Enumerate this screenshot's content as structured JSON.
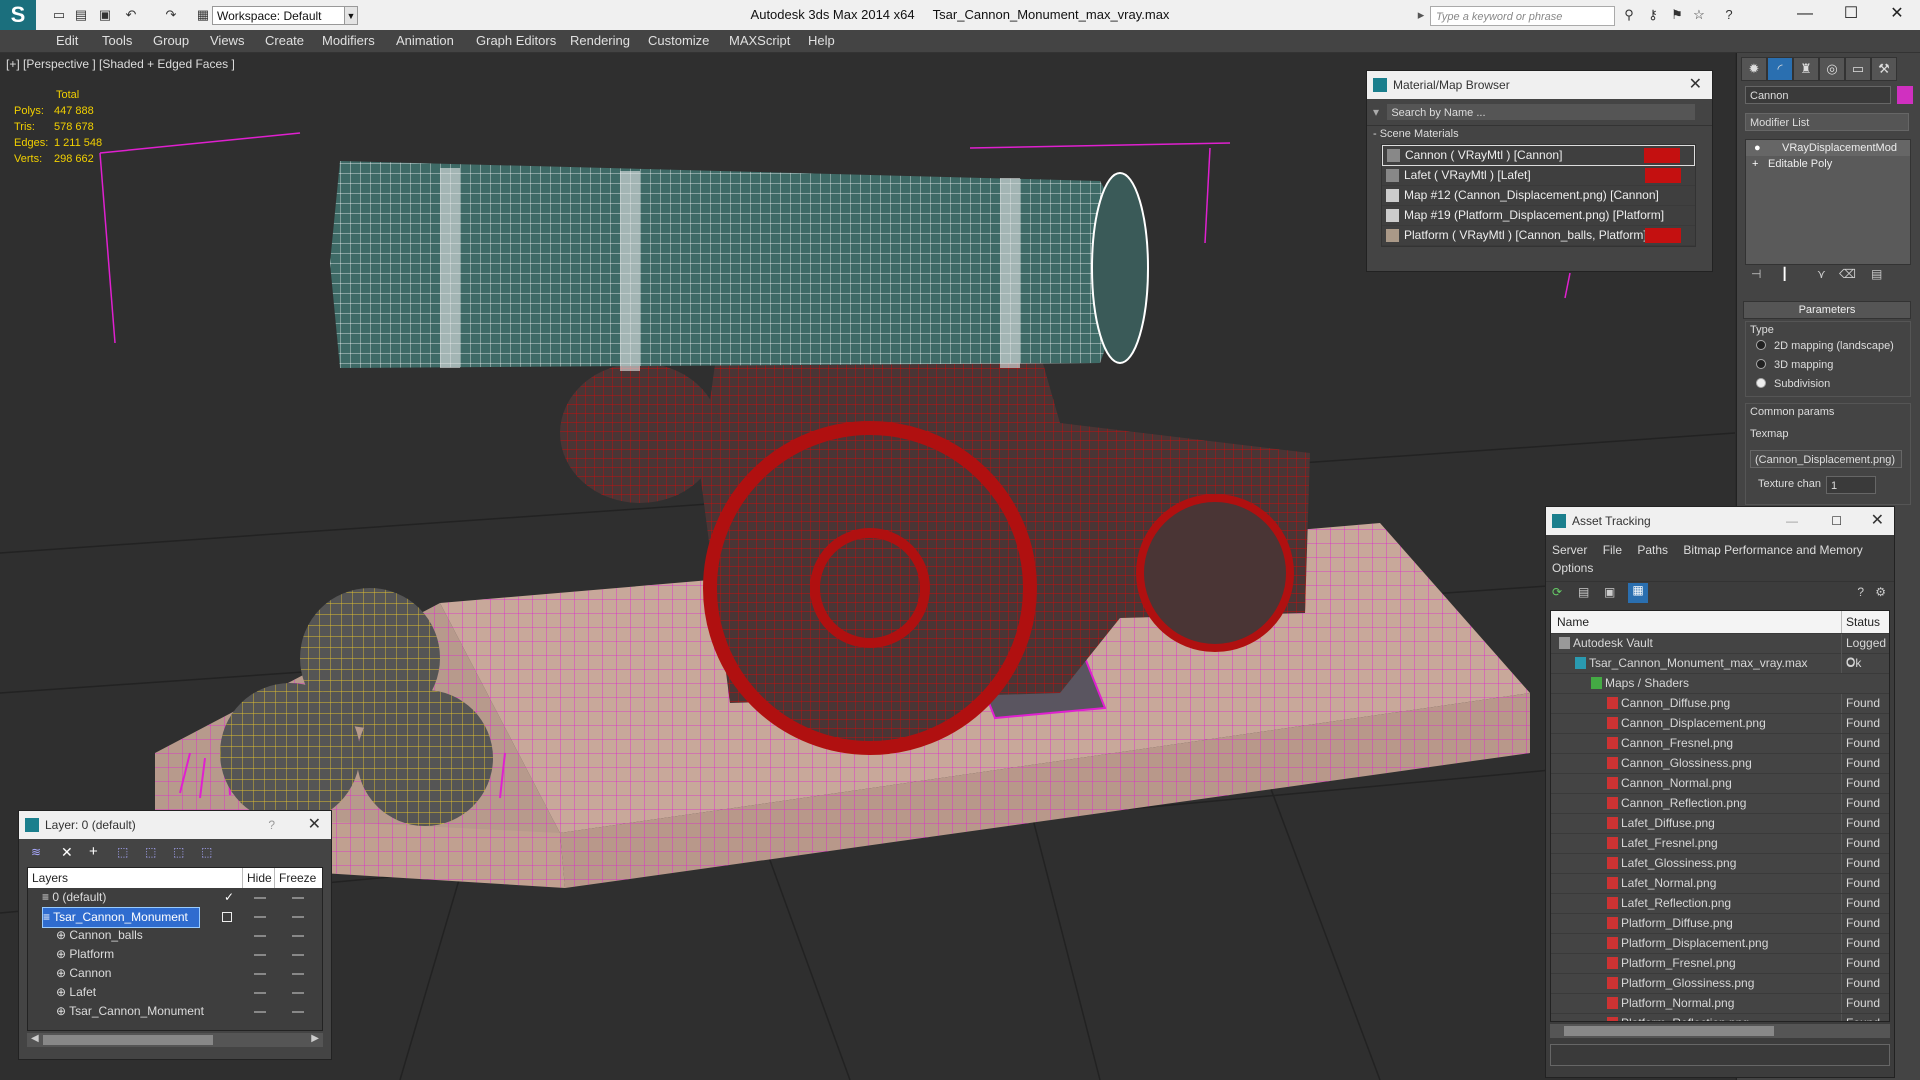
{
  "app": {
    "title": "Autodesk 3ds Max  2014 x64",
    "file": "Tsar_Cannon_Monument_max_vray.max",
    "workspace": "Workspace: Default",
    "search_placeholder": "Type a keyword or phrase"
  },
  "menu": [
    "Edit",
    "Tools",
    "Group",
    "Views",
    "Create",
    "Modifiers",
    "Animation",
    "Graph Editors",
    "Rendering",
    "Customize",
    "MAXScript",
    "Help"
  ],
  "viewport": {
    "label": "[+] [Perspective ] [Shaded + Edged Faces ]",
    "stats_header": "Total",
    "stats": [
      {
        "label": "Polys:",
        "value": "447 888"
      },
      {
        "label": "Tris:",
        "value": "578 678"
      },
      {
        "label": "Edges:",
        "value": "1 211 548"
      },
      {
        "label": "Verts:",
        "value": "298 662"
      }
    ]
  },
  "material_browser": {
    "title": "Material/Map Browser",
    "search_placeholder": "Search by Name ...",
    "section": "- Scene Materials",
    "items": [
      {
        "label": "Cannon  ( VRayMtl ) [Cannon]",
        "red": true
      },
      {
        "label": "Lafet  ( VRayMtl ) [Lafet]",
        "red": true
      },
      {
        "label": "Map #12 (Cannon_Displacement.png) [Cannon]",
        "red": false
      },
      {
        "label": "Map #19 (Platform_Displacement.png) [Platform]",
        "red": false
      },
      {
        "label": "Platform  ( VRayMtl ) [Cannon_balls, Platform]",
        "red": true
      }
    ]
  },
  "command_panel": {
    "object_name": "Cannon",
    "modifier_list": "Modifier List",
    "stack": [
      "VRayDisplacementMod",
      "Editable Poly"
    ],
    "parameters_title": "Parameters",
    "type_label": "Type",
    "type_options": [
      {
        "label": "2D mapping (landscape)",
        "selected": false
      },
      {
        "label": "3D mapping",
        "selected": false
      },
      {
        "label": "Subdivision",
        "selected": true
      }
    ],
    "common_params": "Common params",
    "texmap_label": "Texmap",
    "texmap_value": "(Cannon_Displacement.png)",
    "texture_chan_label": "Texture chan",
    "texture_chan_value": "1"
  },
  "asset_tracking": {
    "title": "Asset Tracking",
    "menu": [
      "Server",
      "File",
      "Paths",
      "Bitmap Performance and Memory",
      "Options"
    ],
    "col_name": "Name",
    "col_status": "Status",
    "rows": [
      {
        "name": "Autodesk Vault",
        "status": "Logged O",
        "level": 0
      },
      {
        "name": "Tsar_Cannon_Monument_max_vray.max",
        "status": "Ok",
        "level": 1
      },
      {
        "name": "Maps / Shaders",
        "status": "",
        "level": 2
      },
      {
        "name": "Cannon_Diffuse.png",
        "status": "Found",
        "level": 3
      },
      {
        "name": "Cannon_Displacement.png",
        "status": "Found",
        "level": 3
      },
      {
        "name": "Cannon_Fresnel.png",
        "status": "Found",
        "level": 3
      },
      {
        "name": "Cannon_Glossiness.png",
        "status": "Found",
        "level": 3
      },
      {
        "name": "Cannon_Normal.png",
        "status": "Found",
        "level": 3
      },
      {
        "name": "Cannon_Reflection.png",
        "status": "Found",
        "level": 3
      },
      {
        "name": "Lafet_Diffuse.png",
        "status": "Found",
        "level": 3
      },
      {
        "name": "Lafet_Fresnel.png",
        "status": "Found",
        "level": 3
      },
      {
        "name": "Lafet_Glossiness.png",
        "status": "Found",
        "level": 3
      },
      {
        "name": "Lafet_Normal.png",
        "status": "Found",
        "level": 3
      },
      {
        "name": "Lafet_Reflection.png",
        "status": "Found",
        "level": 3
      },
      {
        "name": "Platform_Diffuse.png",
        "status": "Found",
        "level": 3
      },
      {
        "name": "Platform_Displacement.png",
        "status": "Found",
        "level": 3
      },
      {
        "name": "Platform_Fresnel.png",
        "status": "Found",
        "level": 3
      },
      {
        "name": "Platform_Glossiness.png",
        "status": "Found",
        "level": 3
      },
      {
        "name": "Platform_Normal.png",
        "status": "Found",
        "level": 3
      },
      {
        "name": "Platform_Reflection.png",
        "status": "Found",
        "level": 3
      }
    ]
  },
  "layers": {
    "title": "Layer: 0 (default)",
    "help": "?",
    "col_layers": "Layers",
    "col_hide": "Hide",
    "col_freeze": "Freeze",
    "rows": [
      {
        "name": "0 (default)",
        "level": 0,
        "selected": false,
        "current": true
      },
      {
        "name": "Tsar_Cannon_Monument",
        "level": 0,
        "selected": true,
        "current": false
      },
      {
        "name": "Cannon_balls",
        "level": 1,
        "selected": false,
        "current": false
      },
      {
        "name": "Platform",
        "level": 1,
        "selected": false,
        "current": false
      },
      {
        "name": "Cannon",
        "level": 1,
        "selected": false,
        "current": false
      },
      {
        "name": "Lafet",
        "level": 1,
        "selected": false,
        "current": false
      },
      {
        "name": "Tsar_Cannon_Monument",
        "level": 1,
        "selected": false,
        "current": false
      }
    ]
  },
  "colors": {
    "accent": "#1b7f8d",
    "selection": "#2f6ccf",
    "stats_yellow": "#f2d000",
    "wire_red": "#b01010",
    "wire_magenta": "#e020d0",
    "wire_yellow": "#e0c030"
  }
}
